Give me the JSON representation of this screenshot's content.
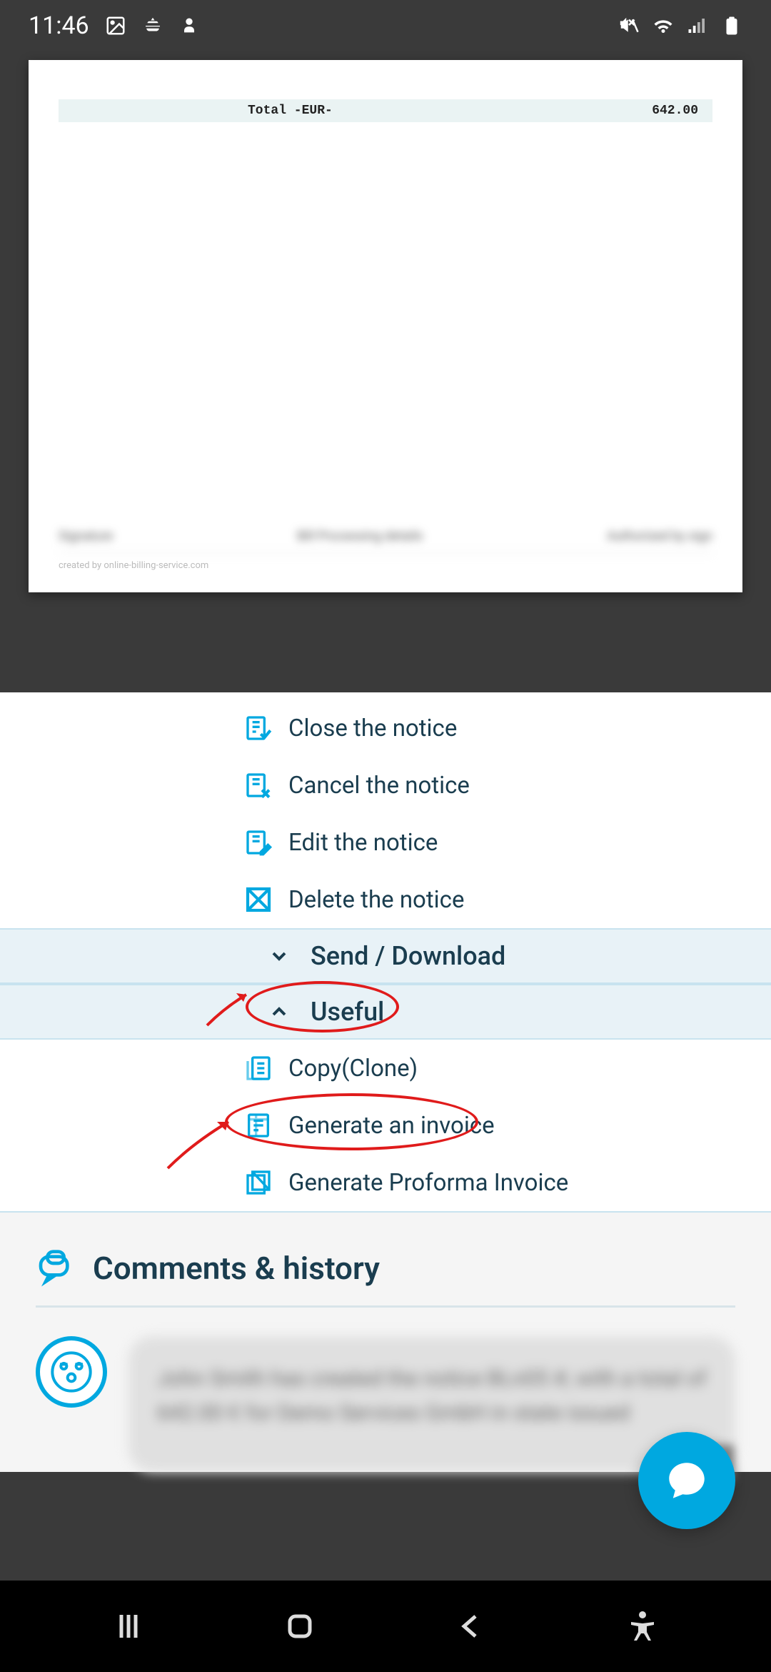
{
  "status": {
    "time": "11:46"
  },
  "document": {
    "total_label": "Total -EUR-",
    "total_value": "642.00",
    "created_by": "created by online-billing-service.com",
    "blurred_a": "Signature",
    "blurred_b": "Bill Processing details",
    "blurred_c": "Authorized by sign"
  },
  "actions": {
    "close": "Close the notice",
    "cancel": "Cancel the notice",
    "edit": "Edit the notice",
    "delete": "Delete the notice",
    "send_download": "Send / Download",
    "useful": "Useful",
    "copy": "Copy(Clone)",
    "generate_invoice": "Generate an invoice",
    "generate_proforma": "Generate Proforma Invoice"
  },
  "comments": {
    "heading": "Comments & history",
    "blurred_text": "John Smith has created the notice BLn05 #, with a total of 642.00 € for Demo Services GmbH in state issued"
  }
}
